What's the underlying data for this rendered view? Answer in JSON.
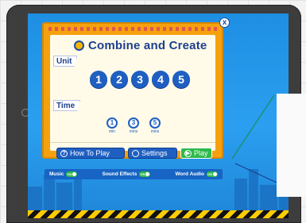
{
  "title": "Combine and Create",
  "close_symbol": "x",
  "unit_label": "Unit",
  "units": [
    "1",
    "2",
    "3",
    "4",
    "5"
  ],
  "time_label": "Time",
  "times": [
    {
      "value": "1",
      "label": "min"
    },
    {
      "value": "3",
      "label": "mins"
    },
    {
      "value": "5",
      "label": "mins"
    }
  ],
  "buttons": {
    "how_to_play": "How To Play",
    "settings": "Settings",
    "play": "Play"
  },
  "toggles": [
    {
      "label": "Music",
      "state": "ON"
    },
    {
      "label": "Sound Effects",
      "state": "ON"
    },
    {
      "label": "Word Audio",
      "state": "ON"
    }
  ],
  "colors": {
    "panel": "#f5a10e",
    "screen": "#2b9ff0",
    "primary": "#1f5fc2",
    "play": "#2fb94a"
  },
  "icons": [
    "title-logo-icon",
    "close-icon",
    "help-icon",
    "settings-icon",
    "play-icon",
    "clock-icon"
  ]
}
